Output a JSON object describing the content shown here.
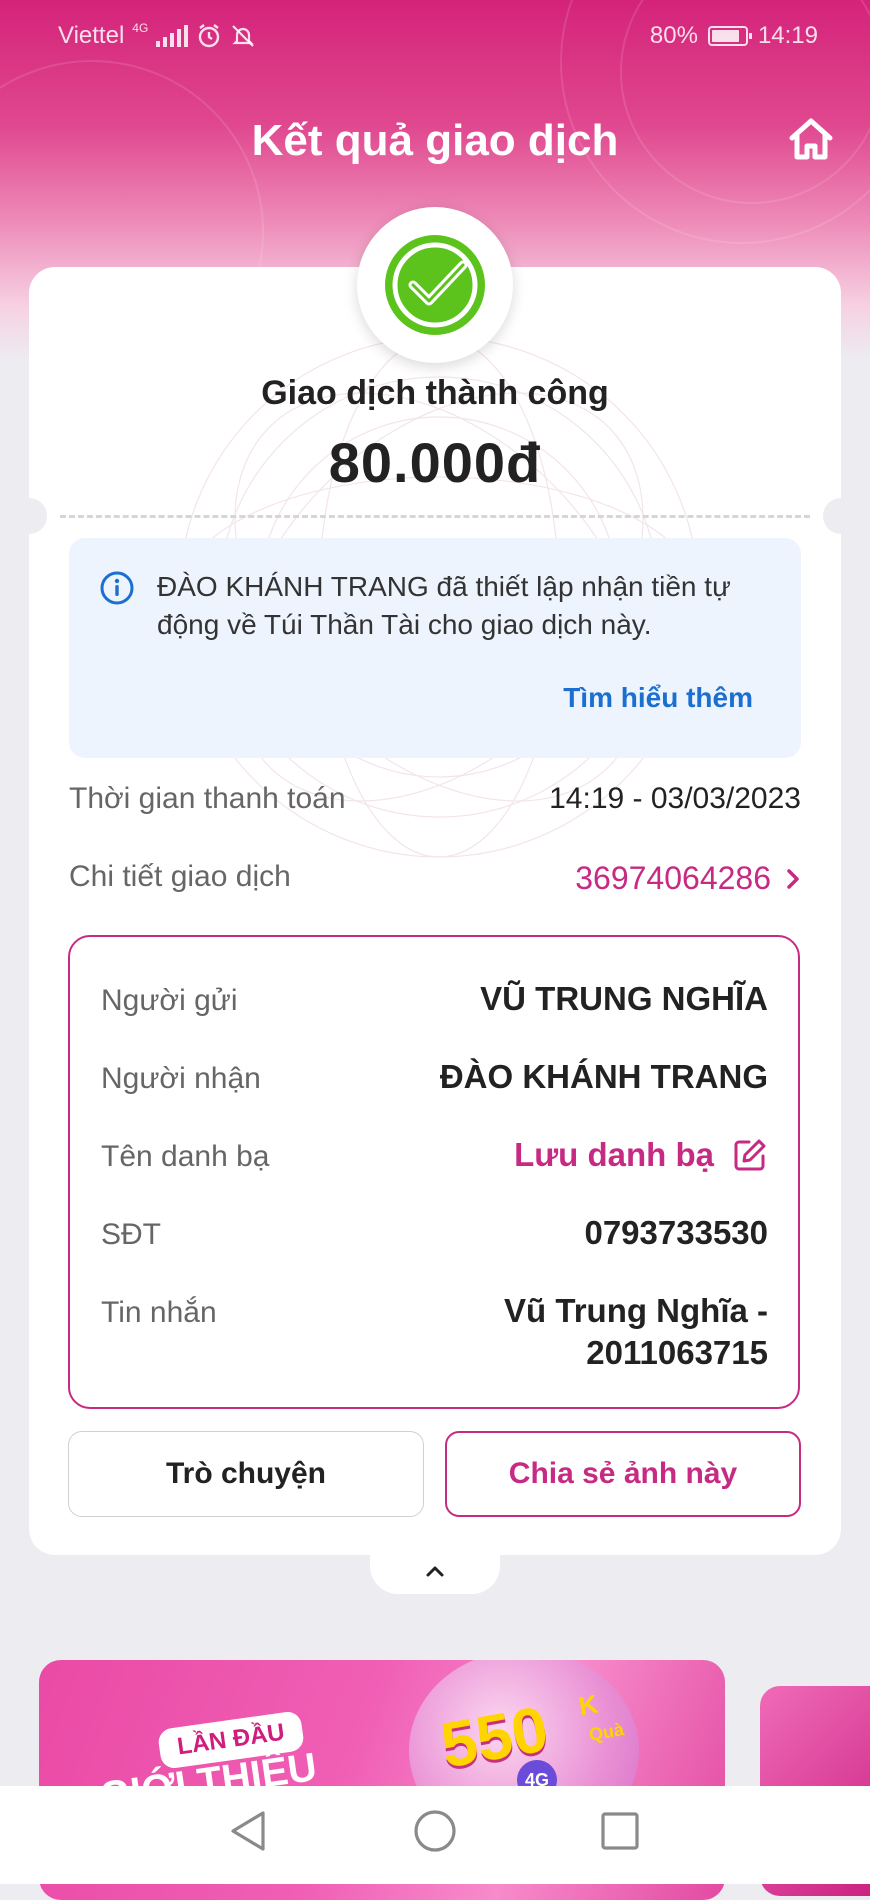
{
  "status_bar": {
    "carrier": "Viettel",
    "network": "4G",
    "battery": "80%",
    "time": "14:19"
  },
  "header": {
    "title": "Kết quả giao dịch",
    "home_icon": "home-icon"
  },
  "result": {
    "status_text": "Giao dịch thành công",
    "amount": "80.000đ",
    "icon": "check-circle-icon"
  },
  "notice": {
    "text": "ĐÀO KHÁNH TRANG đã thiết lập nhận tiền tự động về Túi Thần Tài cho giao dịch này.",
    "link": "Tìm hiểu thêm"
  },
  "summary": {
    "payment_time_label": "Thời gian thanh toán",
    "payment_time_value": "14:19 - 03/03/2023",
    "detail_label": "Chi tiết giao dịch",
    "detail_value": "36974064286"
  },
  "details": {
    "sender_label": "Người gửi",
    "sender_value": "VŨ TRUNG NGHĨA",
    "recipient_label": "Người nhận",
    "recipient_value": "ĐÀO KHÁNH TRANG",
    "contact_label": "Tên danh bạ",
    "contact_action": "Lưu danh bạ",
    "phone_label": "SĐT",
    "phone_value": "0793733530",
    "message_label": "Tin nhắn",
    "message_line1": "Vũ Trung Nghĩa -",
    "message_line2": "2011063715"
  },
  "actions": {
    "chat": "Trò chuyện",
    "share": "Chia sẻ ảnh này"
  },
  "banner": {
    "badge": "LẦN ĐẦU",
    "subtitle": "GIỚI THIỆU",
    "amount": "550",
    "unit": "K",
    "gift": "Quà",
    "tag": "4G"
  },
  "colors": {
    "brand": "#c62a83",
    "success": "#5cc31c",
    "link": "#1a6fd0"
  }
}
